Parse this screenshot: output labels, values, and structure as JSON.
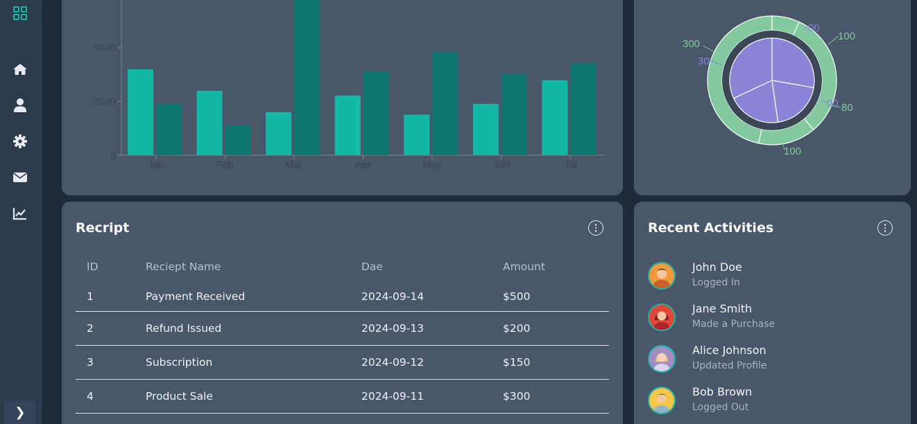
{
  "sidebar": {
    "icons": [
      "dashboard-icon",
      "home-icon",
      "user-icon",
      "gear-icon",
      "envelope-icon",
      "chart-line-icon"
    ],
    "expand_label": "❯"
  },
  "colors": {
    "accent": "#14b8a6",
    "accent_dark": "#0f766e",
    "card_bg": "#4a5669",
    "page_bg": "#1f2a3a",
    "pie_inner": "#8884d8",
    "pie_outer": "#82ca9d"
  },
  "bar_chart": {
    "chart_data": {
      "type": "bar",
      "categories": [
        "Jan",
        "Feb",
        "Mar",
        "Apr",
        "May",
        "Jun",
        "Jul"
      ],
      "series": [
        {
          "values": [
            4000,
            3000,
            2000,
            2780,
            1890,
            2390,
            3490
          ]
        },
        {
          "values": [
            2400,
            1398,
            9800,
            3908,
            4800,
            3800,
            4300
          ]
        }
      ],
      "y_ticks": [
        "0",
        "2500",
        "5000"
      ],
      "ylim": [
        0,
        10000
      ],
      "grid": false
    }
  },
  "pie_chart": {
    "chart_data": {
      "type": "pie",
      "inner": {
        "labels_visible": [
          "300",
          "100",
          "300"
        ]
      },
      "outer": {
        "labels_visible": [
          "300",
          "100",
          "80",
          "100"
        ]
      },
      "labels": [
        "300",
        "100",
        "30",
        "00",
        "80",
        "100",
        "00"
      ]
    }
  },
  "receipt": {
    "title": "Recript",
    "columns": [
      "ID",
      "Reciept Name",
      "Dae",
      "Amount"
    ],
    "rows": [
      [
        "1",
        "Payment Received",
        "2024-09-14",
        "$500"
      ],
      [
        "2",
        "Refund Issued",
        "2024-09-13",
        "$200"
      ],
      [
        "3",
        "Subscription",
        "2024-09-12",
        "$150"
      ],
      [
        "4",
        "Product Sale",
        "2024-09-11",
        "$300"
      ]
    ]
  },
  "activities": {
    "title": "Recent Activities",
    "items": [
      {
        "name": "John Doe",
        "action": "Logged In",
        "avatar": "avatar-orange"
      },
      {
        "name": "Jane Smith",
        "action": "Made a Purchase",
        "avatar": "avatar-red"
      },
      {
        "name": "Alice Johnson",
        "action": "Updated Profile",
        "avatar": "avatar-purple"
      },
      {
        "name": "Bob Brown",
        "action": "Logged Out",
        "avatar": "avatar-yellow"
      }
    ]
  }
}
